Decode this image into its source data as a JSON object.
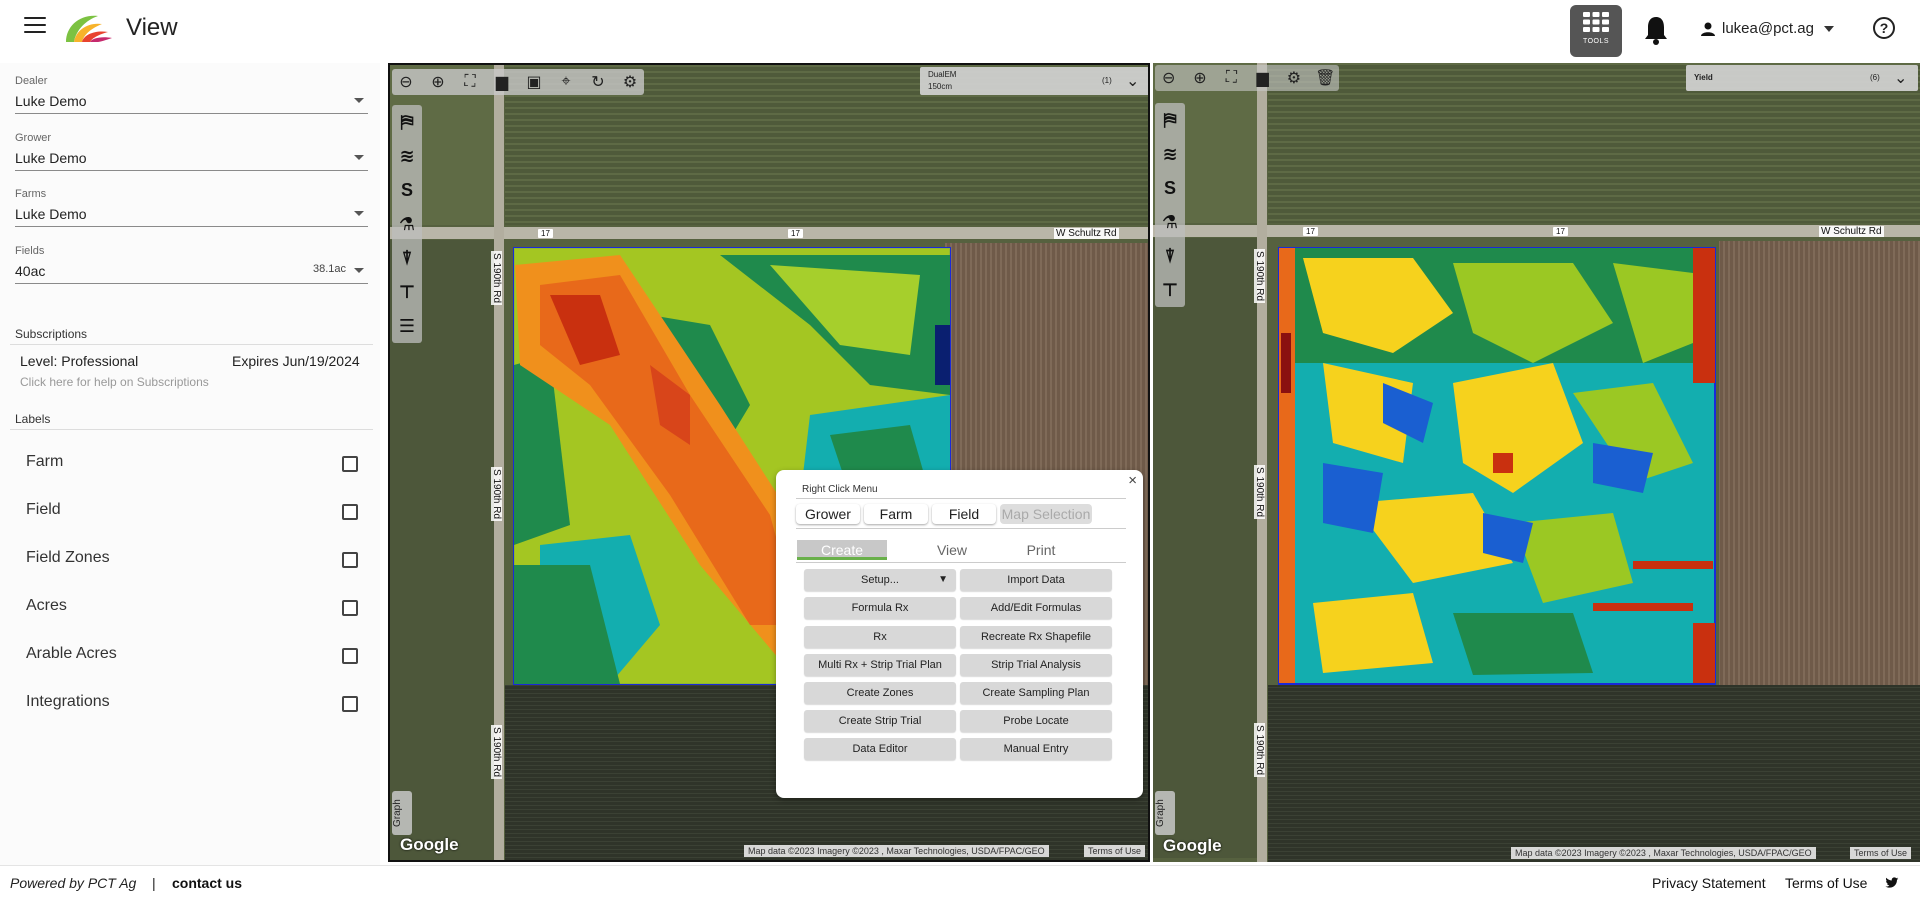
{
  "header": {
    "title": "View",
    "tools_label": "TOOLS",
    "user_email": "lukea@pct.ag",
    "help_symbol": "?"
  },
  "sidebar": {
    "dealer": {
      "caption": "Dealer",
      "value": "Luke Demo"
    },
    "grower": {
      "caption": "Grower",
      "value": "Luke Demo"
    },
    "farms": {
      "caption": "Farms",
      "value": "Luke Demo"
    },
    "fields": {
      "caption": "Fields",
      "value": "40ac",
      "acres": "38.1ac"
    },
    "subscriptions": {
      "title": "Subscriptions",
      "level": "Level: Professional",
      "expires": "Expires Jun/19/2024",
      "help": "Click here for help on Subscriptions"
    },
    "labels": {
      "title": "Labels",
      "items": [
        {
          "label": "Farm",
          "checked": false
        },
        {
          "label": "Field",
          "checked": false
        },
        {
          "label": "Field Zones",
          "checked": false
        },
        {
          "label": "Acres",
          "checked": false
        },
        {
          "label": "Arable Acres",
          "checked": false
        },
        {
          "label": "Integrations",
          "checked": false
        }
      ]
    }
  },
  "map_left": {
    "layer_name": "DualEM",
    "layer_sub": "150cm",
    "layer_count": "(1)",
    "road_h": "W Schultz Rd",
    "road_v": "S 190th Rd",
    "route_badge": "17",
    "google": "Google",
    "attribution": "Map data ©2023 Imagery ©2023 , Maxar Technologies, USDA/FPAC/GEO",
    "terms": "Terms of Use",
    "graph_tab": "Graph"
  },
  "map_right": {
    "layer_name": "Yield",
    "layer_count": "(6)",
    "road_h": "W Schultz Rd",
    "road_v": "S 190th Rd",
    "route_badge": "17",
    "google": "Google",
    "attribution": "Map data ©2023 Imagery ©2023 , Maxar Technologies, USDA/FPAC/GEO",
    "terms": "Terms of Use",
    "graph_tab": "Graph"
  },
  "right_click_menu": {
    "title": "Right Click Menu",
    "close": "×",
    "targets": [
      "Grower",
      "Farm",
      "Field",
      "Map Selection"
    ],
    "tabs": [
      "Create",
      "View",
      "Print"
    ],
    "buttons_left": [
      "Setup...",
      "Formula Rx",
      "Rx",
      "Multi Rx + Strip Trial Plan",
      "Create Zones",
      "Create Strip Trial",
      "Data Editor"
    ],
    "buttons_right": [
      "Import Data",
      "Add/Edit Formulas",
      "Recreate Rx Shapefile",
      "Strip Trial Analysis",
      "Create Sampling Plan",
      "Probe Locate",
      "Manual Entry"
    ]
  },
  "footer": {
    "powered": "Powered by PCT Ag",
    "separator": "|",
    "contact": "contact us",
    "privacy": "Privacy Statement",
    "terms": "Terms of Use"
  }
}
